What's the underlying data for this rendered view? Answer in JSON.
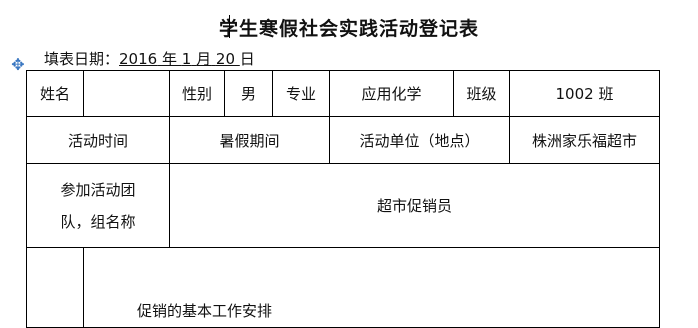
{
  "title": "学生寒假社会实践活动登记表",
  "date": {
    "label": "填表日期：",
    "year": "2016",
    "year_unit": "年",
    "month": "1",
    "month_unit": "月",
    "day": "20",
    "day_unit": "日"
  },
  "row1": {
    "name_label": "姓名",
    "name_value": "",
    "gender_label": "性别",
    "gender_value": "男",
    "major_label": "专业",
    "major_value": "应用化学",
    "class_label": "班级",
    "class_value": "1002 班"
  },
  "row2": {
    "time_label": "活动时间",
    "time_value": "暑假期间",
    "unit_label": "活动单位（地点）",
    "unit_value": "株洲家乐福超市"
  },
  "row3": {
    "team_label_line1": "参加活动团",
    "team_label_line2": "队，组名称",
    "team_value": "超市促销员"
  },
  "row4": {
    "content_partial": "促销的基本工作安排"
  },
  "icons": {
    "move_handle": "move-arrows-icon"
  }
}
